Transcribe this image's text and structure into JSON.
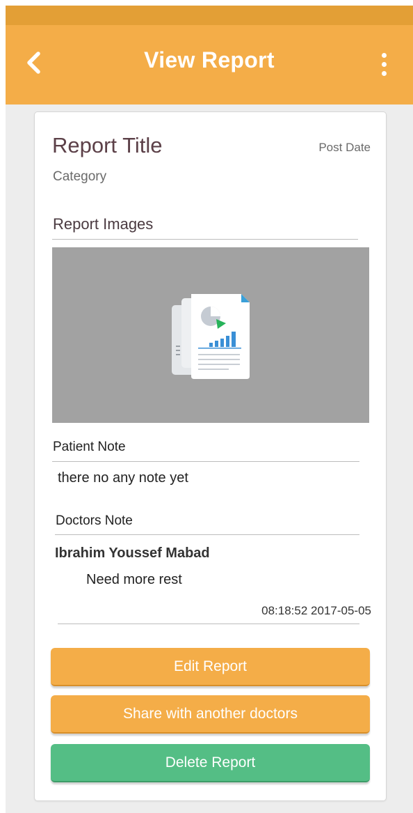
{
  "header": {
    "title": "View Report",
    "back_icon": "chevron-left-icon",
    "menu_icon": "more-vertical-icon"
  },
  "report": {
    "title": "Report Title",
    "post_date": "Post Date",
    "category": "Category",
    "images_heading": "Report Images",
    "image_icon": "report-document-icon"
  },
  "patient_note": {
    "label": "Patient Note",
    "text": "there no any note yet"
  },
  "doctors_note": {
    "label": "Doctors Note",
    "doctor_name": "Ibrahim Youssef Mabad",
    "text": "Need more rest",
    "timestamp": "08:18:52 2017-05-05"
  },
  "actions": {
    "edit_label": "Edit Report",
    "share_label": "Share with another doctors",
    "delete_label": "Delete Report"
  },
  "colors": {
    "app_bar": "#f4ad48",
    "status_bar": "#e39f36",
    "primary_button": "#f4ad48",
    "danger_button": "#54be85",
    "title_text": "#5c4048"
  }
}
